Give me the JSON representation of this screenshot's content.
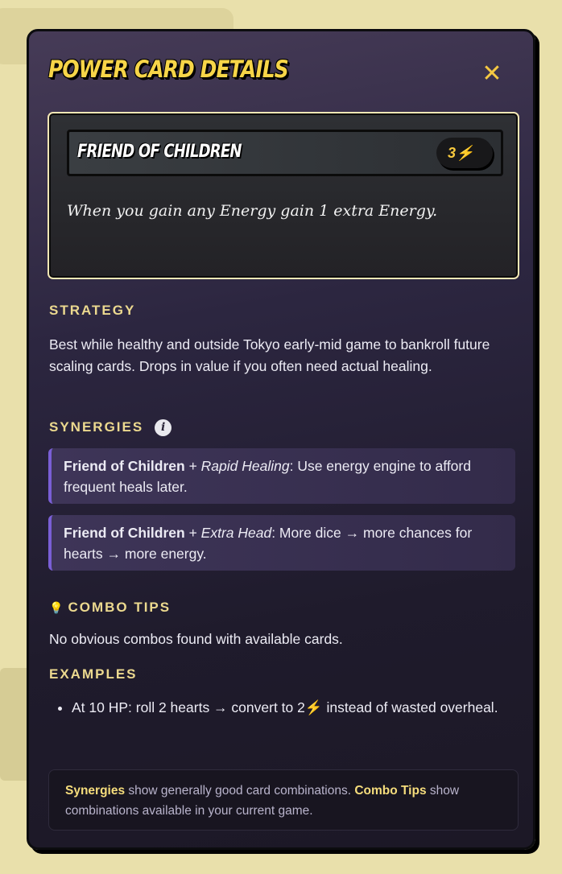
{
  "modal": {
    "title": "POWER CARD DETAILS",
    "close_icon": "close-x-icon",
    "card": {
      "name": "FRIEND OF CHILDREN",
      "cost": "3⚡",
      "text": "When you gain any Energy gain 1 extra Energy."
    },
    "strategy": {
      "heading": "STRATEGY",
      "text": "Best while healthy and outside Tokyo early-mid game to bankroll future scaling cards. Drops in value if you often need actual healing."
    },
    "synergies": {
      "heading": "SYNERGIES",
      "info_icon": "i",
      "items": [
        {
          "card": "Friend of Children",
          "plus": " + ",
          "partner": "Rapid Healing",
          "text": ": Use energy engine to afford frequent heals later."
        },
        {
          "card": "Friend of Children",
          "plus": " + ",
          "partner": "Extra Head",
          "text": ": More dice → more chances for hearts → more energy."
        }
      ]
    },
    "combo_tips": {
      "icon": "💡",
      "heading": "COMBO TIPS",
      "text": "No obvious combos found with available cards."
    },
    "examples": {
      "heading": "EXAMPLES",
      "items": [
        "At 10 HP: roll 2 hearts → convert to 2⚡ instead of wasted overheal."
      ]
    },
    "note": {
      "b1": "Synergies",
      "t1": " show generally good card combinations. ",
      "b2": "Combo Tips",
      "t2": " show combinations available in your current game."
    }
  },
  "colors": {
    "accent": "#f7d548",
    "synergy_border": "#7a5fd6",
    "heading": "#ecd98f"
  }
}
